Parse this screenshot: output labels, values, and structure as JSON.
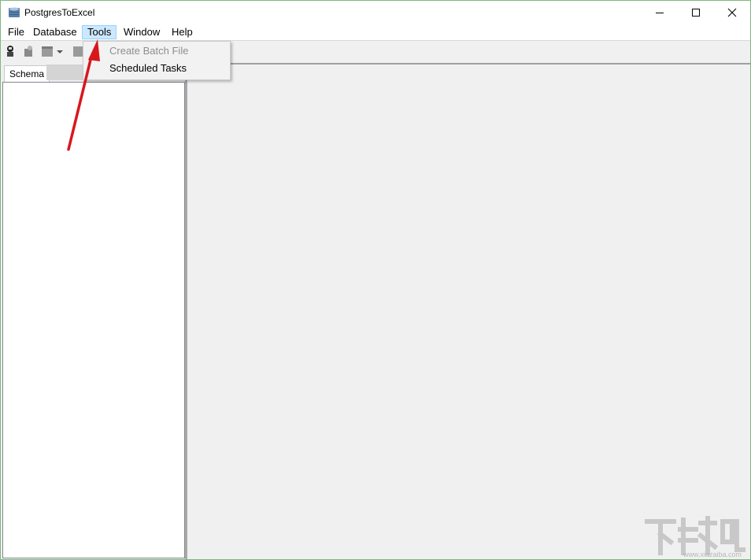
{
  "window": {
    "title": "PostgresToExcel",
    "controls": [
      "minimize",
      "maximize",
      "close"
    ]
  },
  "menubar": {
    "items": [
      {
        "label": "File"
      },
      {
        "label": "Database"
      },
      {
        "label": "Tools",
        "active": true
      },
      {
        "label": "Window"
      },
      {
        "label": "Help"
      }
    ]
  },
  "toolbar": {
    "icons": [
      "connect-icon",
      "disconnect-icon",
      "export-icon",
      "dropdown-arrow-icon",
      "stop-icon"
    ]
  },
  "tools_menu": {
    "items": [
      {
        "label": "Create Batch File",
        "enabled": false
      },
      {
        "label": "Scheduled Tasks",
        "enabled": true
      }
    ]
  },
  "left_panel": {
    "tab_label": "Schema"
  },
  "annotation": {
    "arrow_color": "#d8171d"
  },
  "watermark": {
    "text": "下载吧",
    "url": "www.xiazaiba.com"
  }
}
